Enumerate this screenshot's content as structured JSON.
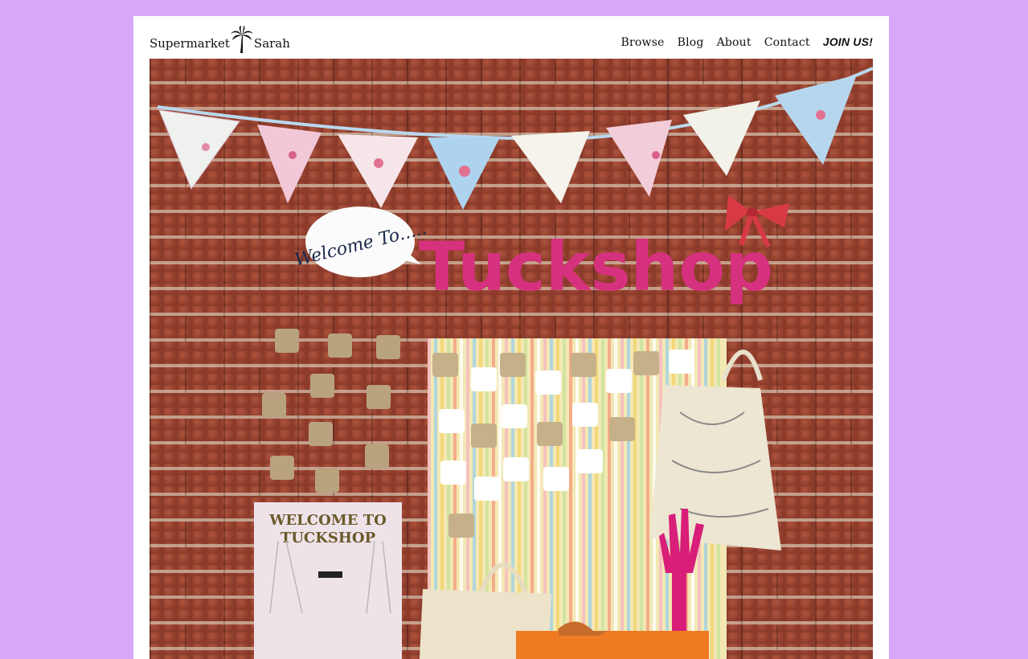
{
  "site": {
    "logo_first": "Supermarket",
    "logo_second": "Sarah",
    "logo_icon": "palm-tree-icon"
  },
  "nav": {
    "items": [
      {
        "label": "Browse"
      },
      {
        "label": "Blog"
      },
      {
        "label": "About"
      },
      {
        "label": "Contact"
      }
    ],
    "join_label": "JOIN US!"
  },
  "hero": {
    "speech_bubble_text": "Welcome To.....",
    "banner_text": "Tuckshop",
    "sign_line_1": "WELCOME TO",
    "sign_line_2": "TUCKSHOP"
  },
  "colors": {
    "background": "#d7a8f7",
    "page": "#ffffff",
    "brick": "#9a4431",
    "accent_pink": "#d6317e"
  }
}
